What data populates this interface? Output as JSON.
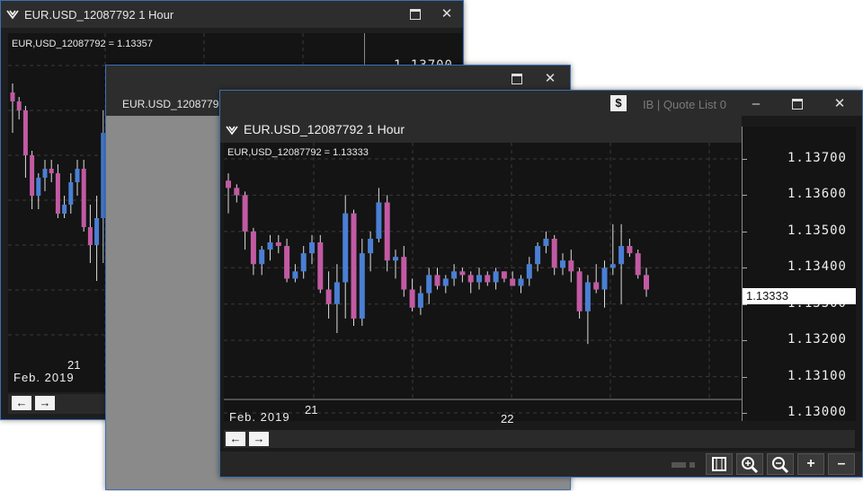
{
  "colors": {
    "bull": "#4a7fd4",
    "bear": "#c25aa3",
    "wick": "#dddddd",
    "frame": "#3b6fb5"
  },
  "windows": {
    "back": {
      "title": "EUR.USD_12087792 1 Hour",
      "header": "EUR,USD_12087792 = 1.13357",
      "price_label": "1.13700",
      "date_tick": "21",
      "month_label": "Feb. 2019",
      "maximize_icon": "maximize-icon",
      "close_glyph": "✕"
    },
    "middle": {
      "title": "EUR.USD_12087792 1 Hour",
      "maximize_icon": "maximize-icon",
      "close_glyph": "✕"
    },
    "front": {
      "title": "EUR.USD_12087792 1 Hour",
      "header": "EUR,USD_12087792 = 1.13333",
      "quote_list": "IB | Quote List 0",
      "minimize_glyph": "–",
      "close_glyph": "✕",
      "month_label": "Feb. 2019",
      "date_ticks": [
        "21",
        "22"
      ],
      "current_price": "1.13333",
      "nav": {
        "left": "←",
        "right": "→"
      },
      "status_buttons": {
        "zoom_in": "zoom-in-icon",
        "zoom_out": "zoom-out-icon",
        "plus": "+",
        "minus": "–",
        "film": "film-icon"
      }
    }
  },
  "chart_data": {
    "type": "candlestick",
    "header": "EUR,USD_12087792 = 1.13333",
    "x_labels": [
      "21",
      "22"
    ],
    "month_label": "Feb. 2019",
    "ylim": [
      1.13,
      1.137
    ],
    "y_ticks": [
      "1.13700",
      "1.13600",
      "1.13500",
      "1.13400",
      "1.13300",
      "1.13200",
      "1.13100",
      "1.13000"
    ],
    "grid": true,
    "candles": [
      [
        1.1364,
        1.1366,
        1.1355,
        1.1362
      ],
      [
        1.1362,
        1.1363,
        1.1358,
        1.136
      ],
      [
        1.136,
        1.1361,
        1.1345,
        1.135
      ],
      [
        1.135,
        1.1351,
        1.1338,
        1.1341
      ],
      [
        1.1341,
        1.1346,
        1.1338,
        1.1345
      ],
      [
        1.1345,
        1.1349,
        1.1342,
        1.1347
      ],
      [
        1.1347,
        1.1349,
        1.1344,
        1.1346
      ],
      [
        1.1346,
        1.1348,
        1.1336,
        1.1337
      ],
      [
        1.1337,
        1.1341,
        1.1336,
        1.1339
      ],
      [
        1.1339,
        1.1346,
        1.1337,
        1.1344
      ],
      [
        1.1344,
        1.1349,
        1.1341,
        1.1347
      ],
      [
        1.1347,
        1.1349,
        1.1333,
        1.1334
      ],
      [
        1.1334,
        1.1339,
        1.1326,
        1.133
      ],
      [
        1.133,
        1.1341,
        1.1322,
        1.1336
      ],
      [
        1.1336,
        1.136,
        1.1326,
        1.1355
      ],
      [
        1.1355,
        1.1356,
        1.1324,
        1.1326
      ],
      [
        1.1326,
        1.1348,
        1.1324,
        1.1344
      ],
      [
        1.1344,
        1.135,
        1.1339,
        1.1348
      ],
      [
        1.1348,
        1.1362,
        1.1347,
        1.1358
      ],
      [
        1.1358,
        1.136,
        1.1339,
        1.1342
      ],
      [
        1.1342,
        1.1345,
        1.1337,
        1.1343
      ],
      [
        1.1343,
        1.1346,
        1.1332,
        1.1334
      ],
      [
        1.1334,
        1.1337,
        1.1328,
        1.1329
      ],
      [
        1.1329,
        1.1335,
        1.1327,
        1.1333
      ],
      [
        1.1333,
        1.134,
        1.133,
        1.1338
      ],
      [
        1.1338,
        1.134,
        1.1334,
        1.1335
      ],
      [
        1.1335,
        1.1338,
        1.1333,
        1.1337
      ],
      [
        1.1337,
        1.1341,
        1.1335,
        1.1339
      ],
      [
        1.1339,
        1.134,
        1.1336,
        1.1338
      ],
      [
        1.1338,
        1.1339,
        1.1333,
        1.1336
      ],
      [
        1.1336,
        1.134,
        1.1334,
        1.1338
      ],
      [
        1.1338,
        1.1339,
        1.1335,
        1.1336
      ],
      [
        1.1336,
        1.134,
        1.1334,
        1.1339
      ],
      [
        1.1339,
        1.1339,
        1.1336,
        1.1337
      ],
      [
        1.1337,
        1.1339,
        1.1335,
        1.1335
      ],
      [
        1.1335,
        1.1338,
        1.1333,
        1.1337
      ],
      [
        1.1337,
        1.1343,
        1.1335,
        1.1341
      ],
      [
        1.1341,
        1.1347,
        1.1339,
        1.1346
      ],
      [
        1.1346,
        1.135,
        1.1344,
        1.1348
      ],
      [
        1.1348,
        1.1349,
        1.1338,
        1.134
      ],
      [
        1.134,
        1.1344,
        1.1338,
        1.1342
      ],
      [
        1.1342,
        1.1345,
        1.1336,
        1.1339
      ],
      [
        1.1339,
        1.134,
        1.1326,
        1.1328
      ],
      [
        1.1328,
        1.1338,
        1.1319,
        1.1336
      ],
      [
        1.1336,
        1.1341,
        1.1333,
        1.1334
      ],
      [
        1.1334,
        1.1342,
        1.1329,
        1.134
      ],
      [
        1.134,
        1.1352,
        1.1338,
        1.1341
      ],
      [
        1.1341,
        1.1352,
        1.133,
        1.1346
      ],
      [
        1.1346,
        1.1348,
        1.1343,
        1.1344
      ],
      [
        1.1344,
        1.1345,
        1.1337,
        1.1338
      ],
      [
        1.1338,
        1.134,
        1.1332,
        1.1334
      ]
    ]
  }
}
